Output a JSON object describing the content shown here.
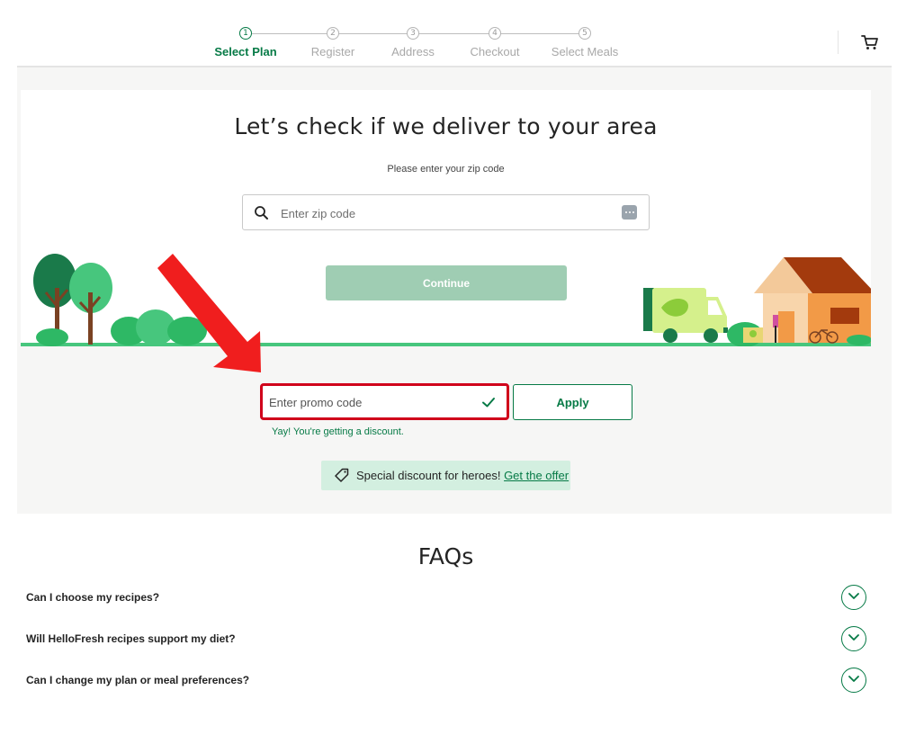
{
  "stepper": {
    "steps": [
      {
        "number": "1",
        "label": "Select Plan",
        "active": true
      },
      {
        "number": "2",
        "label": "Register",
        "active": false
      },
      {
        "number": "3",
        "label": "Address",
        "active": false
      },
      {
        "number": "4",
        "label": "Checkout",
        "active": false
      },
      {
        "number": "5",
        "label": "Select Meals",
        "active": false
      }
    ]
  },
  "header": {
    "cart_icon": "cart-icon"
  },
  "delivery": {
    "title": "Let’s check if we deliver to your area",
    "subtitle": "Please enter your zip code",
    "zip_placeholder": "Enter zip code",
    "continue_label": "Continue"
  },
  "promo": {
    "placeholder": "Enter promo code",
    "apply_label": "Apply",
    "success_message": "Yay! You're getting a discount.",
    "heroes_text": "Special discount for heroes!",
    "heroes_link": "Get the offer"
  },
  "faq": {
    "title": "FAQs",
    "items": [
      {
        "question": "Can I choose my recipes?"
      },
      {
        "question": "Will HelloFresh recipes support my diet?"
      },
      {
        "question": "Can I change my plan or meal preferences?"
      }
    ]
  },
  "colors": {
    "brand_green": "#067a46",
    "continue_disabled": "#9fcdb3",
    "highlight_red": "#d0021b",
    "banner_bg": "#d3efe0"
  }
}
